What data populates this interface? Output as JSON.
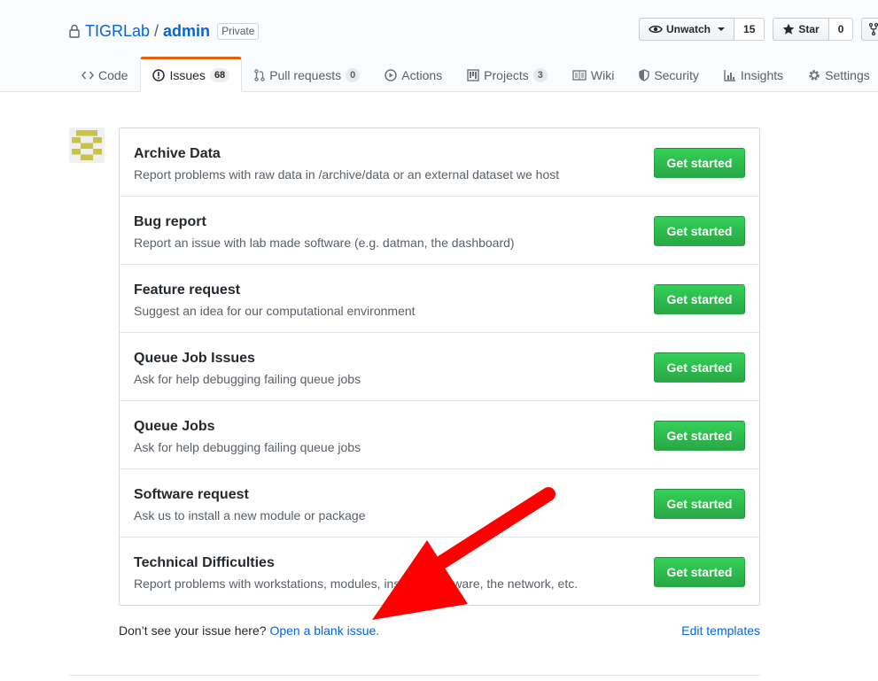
{
  "repo": {
    "owner": "TIGRLab",
    "separator": "/",
    "name": "admin",
    "visibility": "Private"
  },
  "actions": {
    "watch": {
      "label": "Unwatch",
      "count": "15"
    },
    "star": {
      "label": "Star",
      "count": "0"
    }
  },
  "nav": {
    "items": [
      {
        "label": "Code",
        "icon": "code-icon"
      },
      {
        "label": "Issues",
        "icon": "issue-opened-icon",
        "counter": "68",
        "selected": true
      },
      {
        "label": "Pull requests",
        "icon": "git-pull-request-icon",
        "counter": "0"
      },
      {
        "label": "Actions",
        "icon": "play-icon"
      },
      {
        "label": "Projects",
        "icon": "project-icon",
        "counter": "3"
      },
      {
        "label": "Wiki",
        "icon": "book-icon"
      },
      {
        "label": "Security",
        "icon": "shield-icon"
      },
      {
        "label": "Insights",
        "icon": "graph-icon"
      },
      {
        "label": "Settings",
        "icon": "gear-icon"
      }
    ]
  },
  "templates": [
    {
      "name": "Archive Data",
      "description": "Report problems with raw data in /archive/data or an external dataset we host",
      "button": "Get started"
    },
    {
      "name": "Bug report",
      "description": "Report an issue with lab made software (e.g. datman, the dashboard)",
      "button": "Get started"
    },
    {
      "name": "Feature request",
      "description": "Suggest an idea for our computational environment",
      "button": "Get started"
    },
    {
      "name": "Queue Job Issues",
      "description": "Ask for help debugging failing queue jobs",
      "button": "Get started"
    },
    {
      "name": "Queue Jobs",
      "description": "Ask for help debugging failing queue jobs",
      "button": "Get started"
    },
    {
      "name": "Software request",
      "description": "Ask us to install a new module or package",
      "button": "Get started"
    },
    {
      "name": "Technical Difficulties",
      "description": "Report problems with workstations, modules, installed software, the network, etc.",
      "button": "Get started"
    }
  ],
  "footer": {
    "prompt": "Don’t see your issue here?",
    "blank_issue_link": "Open a blank issue.",
    "edit_templates_link": "Edit templates"
  },
  "colors": {
    "link": "#0366d6",
    "primary_button": "#28a745",
    "selected_tab_accent": "#e36209",
    "annotation_arrow": "#ff0000"
  }
}
